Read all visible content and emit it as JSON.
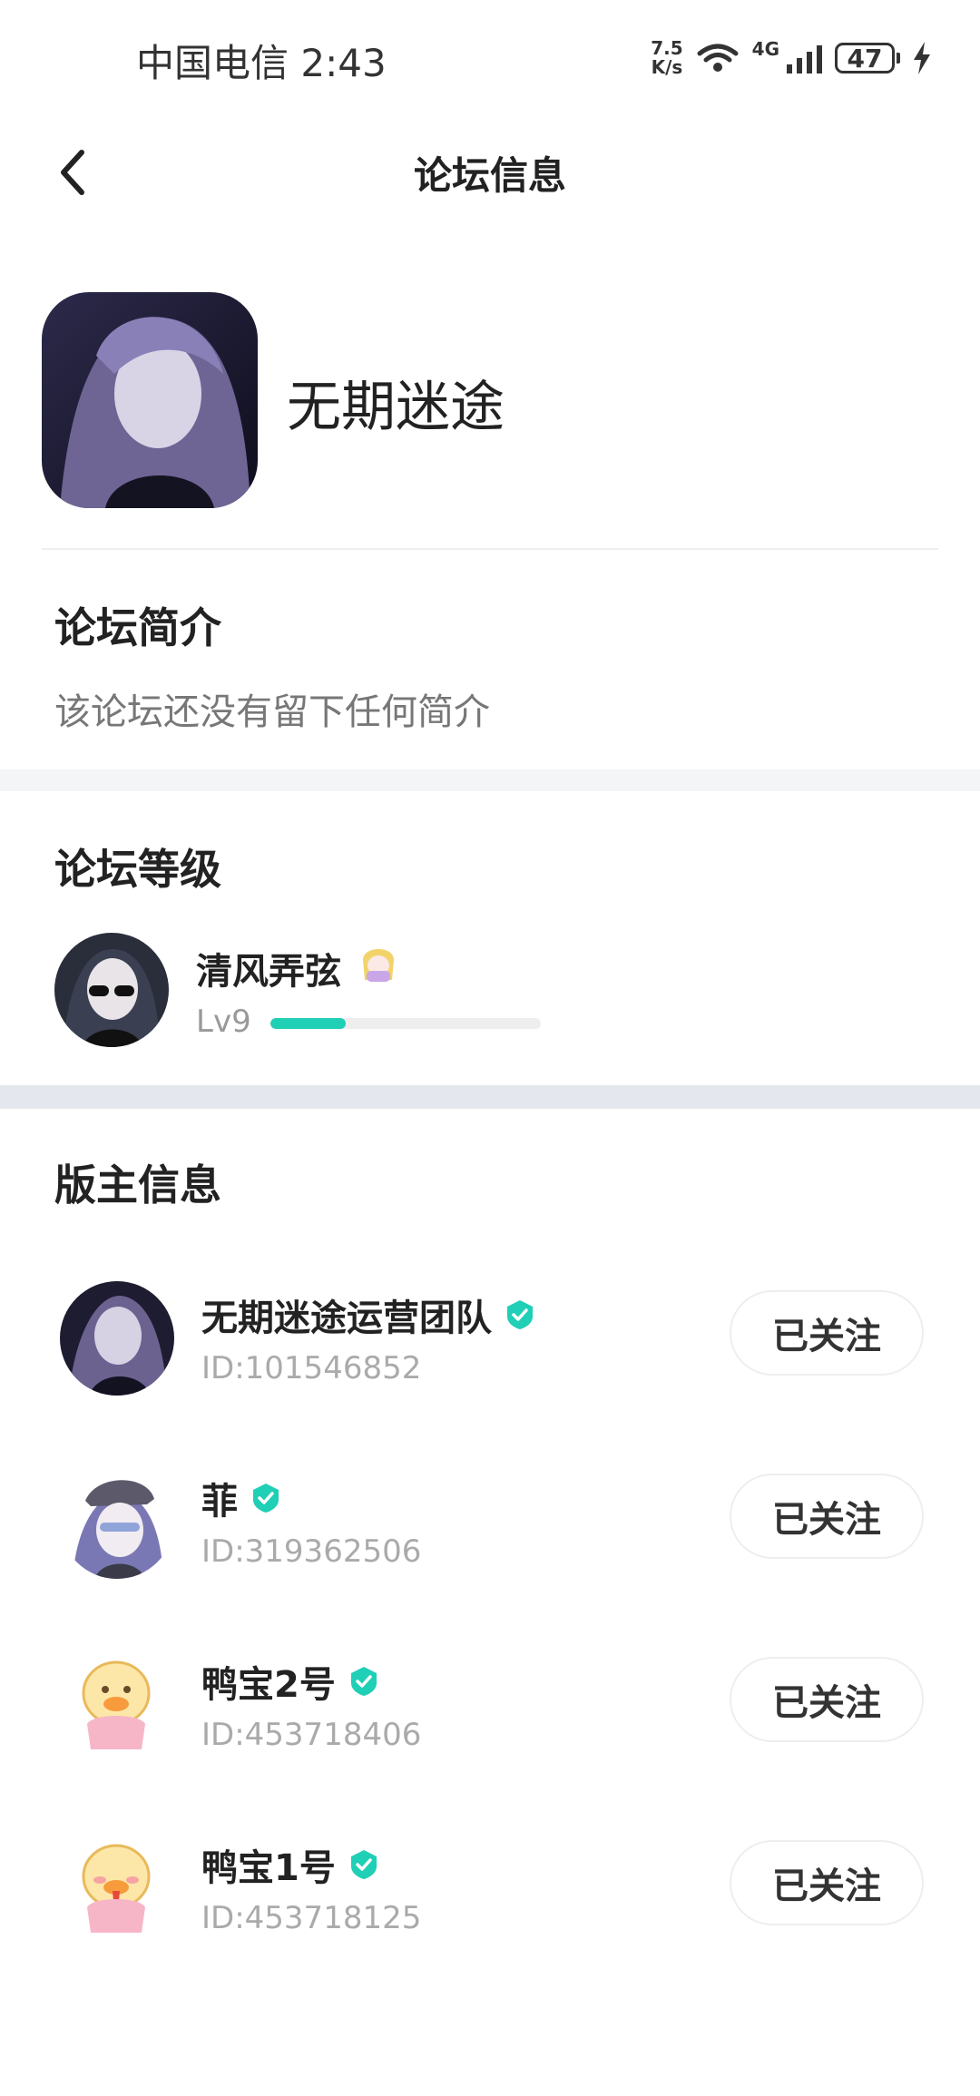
{
  "status_bar": {
    "carrier_time": "中国电信 2:43",
    "net_speed_value": "7.5",
    "net_speed_unit": "K/s",
    "network_type": "4G",
    "battery": "47"
  },
  "nav": {
    "title": "论坛信息"
  },
  "forum": {
    "name": "无期迷途"
  },
  "intro": {
    "title": "论坛简介",
    "text": "该论坛还没有留下任何简介"
  },
  "level": {
    "title": "论坛等级",
    "user_name": "清风弄弦",
    "lv": "Lv9",
    "progress": 0.28,
    "accent": "#1fcfb6"
  },
  "moderators": {
    "title": "版主信息",
    "items": [
      {
        "name": "无期迷途运营团队",
        "id": "ID:101546852",
        "follow": "已关注"
      },
      {
        "name": "菲",
        "id": "ID:319362506",
        "follow": "已关注"
      },
      {
        "name": "鸭宝2号",
        "id": "ID:453718406",
        "follow": "已关注"
      },
      {
        "name": "鸭宝1号",
        "id": "ID:453718125",
        "follow": "已关注"
      }
    ]
  }
}
